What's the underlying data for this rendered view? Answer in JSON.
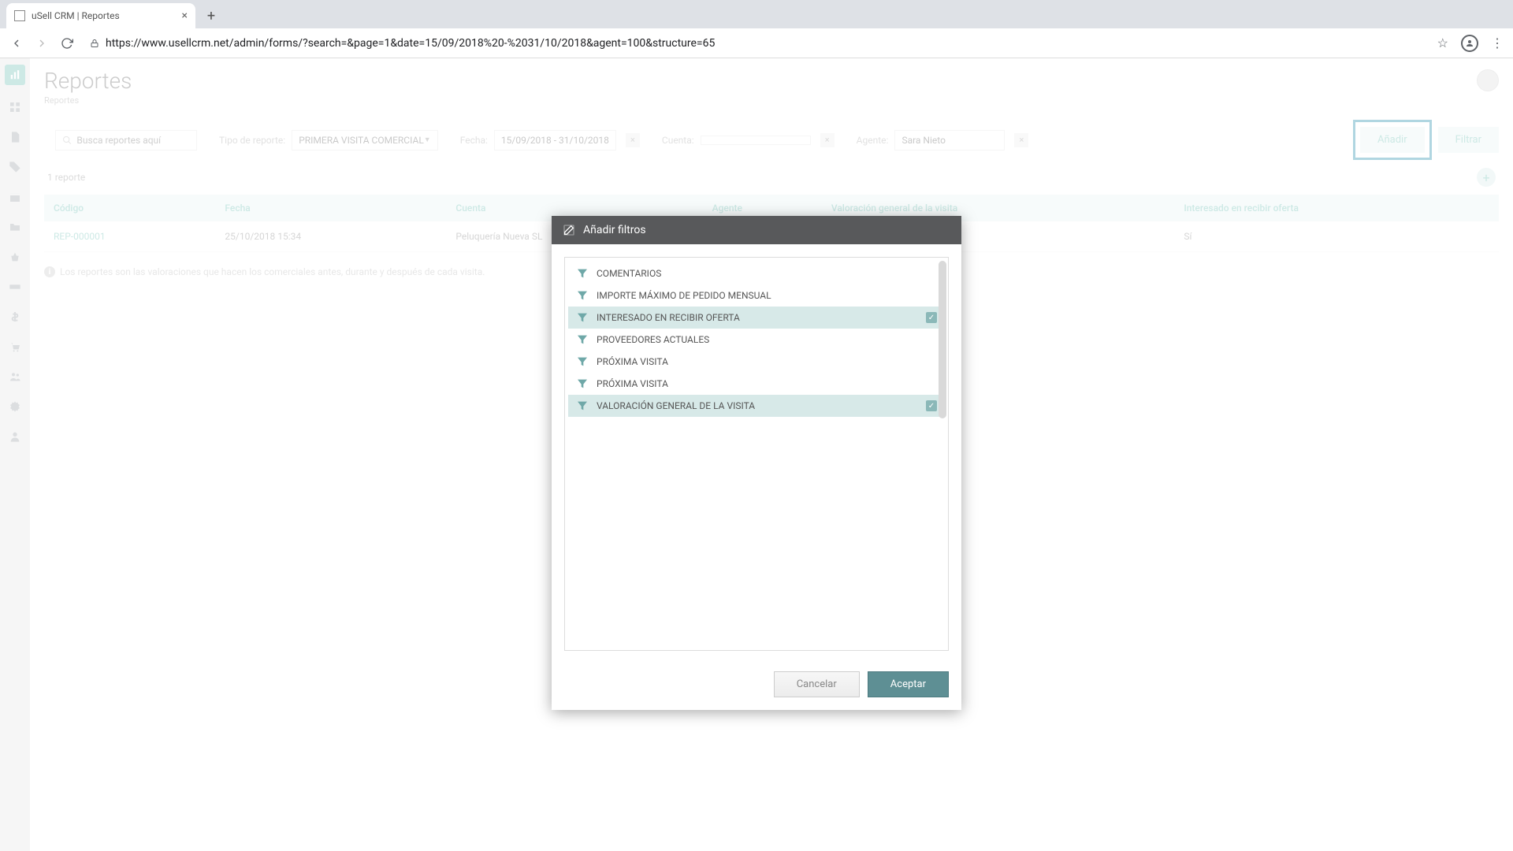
{
  "browser": {
    "tab_title": "uSell CRM | Reportes",
    "url": "https://www.usellcrm.net/admin/forms/?search=&page=1&date=15/09/2018%20-%2031/10/2018&agent=100&structure=65"
  },
  "page": {
    "title": "Reportes",
    "breadcrumb": "Reportes"
  },
  "filters": {
    "search_placeholder": "Busca reportes aquí",
    "type_label": "Tipo de reporte:",
    "type_value": "PRIMERA VISITA COMERCIAL",
    "date_label": "Fecha:",
    "date_value": "15/09/2018 - 31/10/2018",
    "account_label": "Cuenta:",
    "account_value": "",
    "agent_label": "Agente:",
    "agent_value": "Sara Nieto",
    "add_btn": "Añadir",
    "filter_btn": "Filtrar"
  },
  "count_label": "1 reporte",
  "table": {
    "headers": [
      "Código",
      "Fecha",
      "Cuenta",
      "Agente",
      "Valoración general de la visita",
      "Interesado en recibir oferta"
    ],
    "rows": [
      {
        "code": "REP-000001",
        "date": "25/10/2018 15:34",
        "account": "Peluquería Nueva SL",
        "agent": "",
        "val": "",
        "interested": "Sí"
      }
    ]
  },
  "info_note": "Los reportes son las valoraciones que hacen los comerciales antes, durante y después de cada visita.",
  "modal": {
    "title": "Añadir filtros",
    "items": [
      {
        "label": "COMENTARIOS",
        "selected": false
      },
      {
        "label": "IMPORTE MÁXIMO DE PEDIDO MENSUAL",
        "selected": false
      },
      {
        "label": "INTERESADO EN RECIBIR OFERTA",
        "selected": true
      },
      {
        "label": "PROVEEDORES ACTUALES",
        "selected": false
      },
      {
        "label": "PRÓXIMA VISITA",
        "selected": false
      },
      {
        "label": "PRÓXIMA VISITA",
        "selected": false
      },
      {
        "label": "VALORACIÓN GENERAL DE LA VISITA",
        "selected": true
      }
    ],
    "cancel": "Cancelar",
    "accept": "Aceptar"
  }
}
